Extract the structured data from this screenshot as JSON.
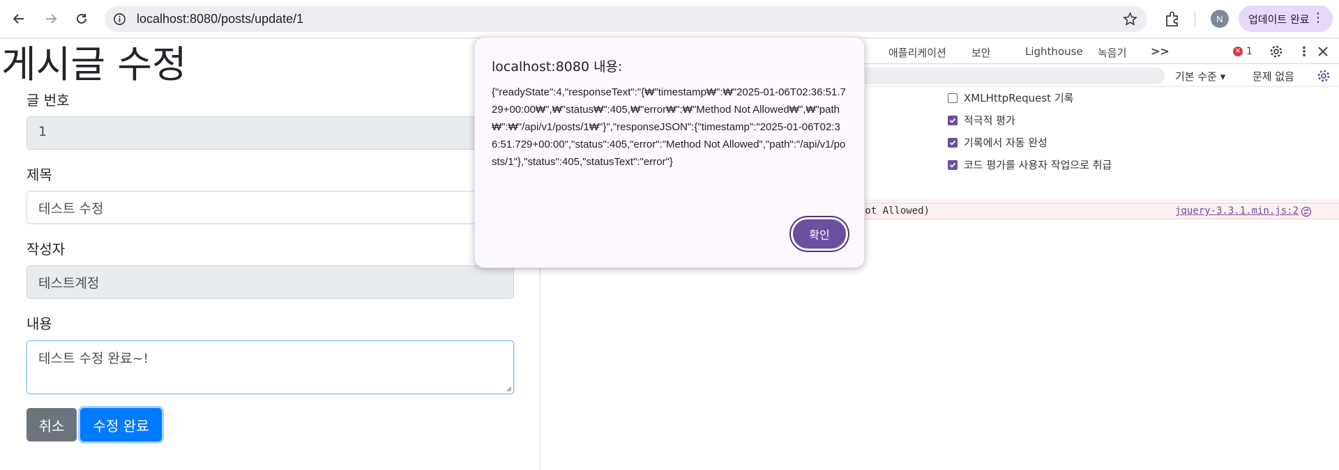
{
  "browser": {
    "url": "localhost:8080/posts/update/1",
    "update_button": "업데이트 완료",
    "profile_initial": "N"
  },
  "page": {
    "title": "게시글 수정",
    "fields": {
      "id_label": "글 번호",
      "id_value": "1",
      "title_label": "제목",
      "title_value": "테스트 수정",
      "author_label": "작성자",
      "author_value": "테스트계정",
      "content_label": "내용",
      "content_value": "테스트 수정 완료~!"
    },
    "buttons": {
      "cancel": "취소",
      "save": "수정 완료"
    }
  },
  "devtools": {
    "tabs": [
      "애플리케이션",
      "보안",
      "Lighthouse",
      "녹음기"
    ],
    "more": ">>",
    "error_count": "1",
    "level_label": "기본 수준",
    "issues_label": "문제 없음",
    "settings": [
      {
        "label": "XMLHttpRequest 기록",
        "checked": false
      },
      {
        "label": "적극적 평가",
        "checked": true
      },
      {
        "label": "기록에서 자동 완성",
        "checked": true
      },
      {
        "label": "코드 평가를 사용자 작업으로 취급",
        "checked": true
      }
    ],
    "error_row_text": "d Not Allowed)",
    "error_row_link": "jquery-3.3.1.min.js:2"
  },
  "dialog": {
    "title": "localhost:8080 내용:",
    "message": "{\"readyState\":4,\"responseText\":\"{₩\"timestamp₩\":₩\"2025-01-06T02:36:51.729+00:00₩\",₩\"status₩\":405,₩\"error₩\":₩\"Method Not Allowed₩\",₩\"path₩\":₩\"/api/v1/posts/1₩\"}\",\"responseJSON\":{\"timestamp\":\"2025-01-06T02:36:51.729+00:00\",\"status\":405,\"error\":\"Method Not Allowed\",\"path\":\"/api/v1/posts/1\"},\"status\":405,\"statusText\":\"error\"}",
    "ok_button": "확인"
  },
  "colors": {
    "primary": "#007bff",
    "secondary": "#6c757d",
    "dialog_accent": "#6b4fa0",
    "error": "#dc3545"
  }
}
